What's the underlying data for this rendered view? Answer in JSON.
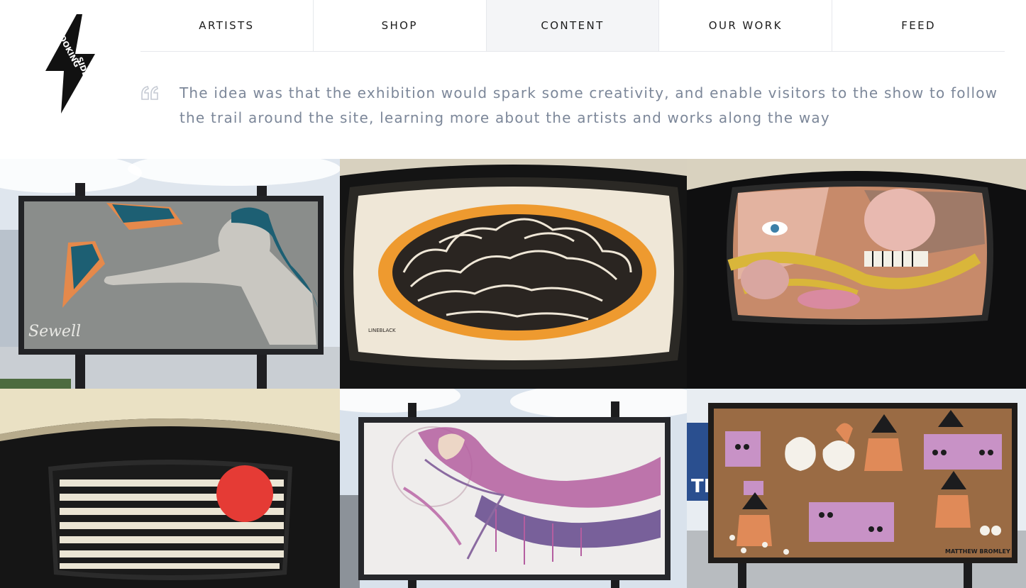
{
  "logo": {
    "line1": "LOOKING",
    "line2": "SIDEWAYS"
  },
  "nav": {
    "items": [
      {
        "label": "ARTISTS"
      },
      {
        "label": "SHOP"
      },
      {
        "label": "CONTENT",
        "active": true
      },
      {
        "label": "OUR WORK"
      },
      {
        "label": "FEED"
      }
    ]
  },
  "quote": {
    "text": "The idea was that the exhibition would spark some creativity, and enable visitors to the show to follow the trail around the site, learning more about the artists and works along the way"
  },
  "gallery": {
    "artworks": [
      {
        "name": "birds-and-woman-artwork",
        "signature": "Sewell"
      },
      {
        "name": "black-line-clouds-artwork"
      },
      {
        "name": "pop-art-skull-artwork"
      },
      {
        "name": "striped-red-sun-artwork"
      },
      {
        "name": "purple-flowing-woman-artwork"
      },
      {
        "name": "character-illustration-artwork",
        "signature": "MATTHEW BROMLEY"
      }
    ]
  },
  "colors": {
    "nav_border": "#e6e8ec",
    "nav_active_bg": "#f4f5f7",
    "quote_text": "#7c8799",
    "logo_fill": "#111111"
  }
}
